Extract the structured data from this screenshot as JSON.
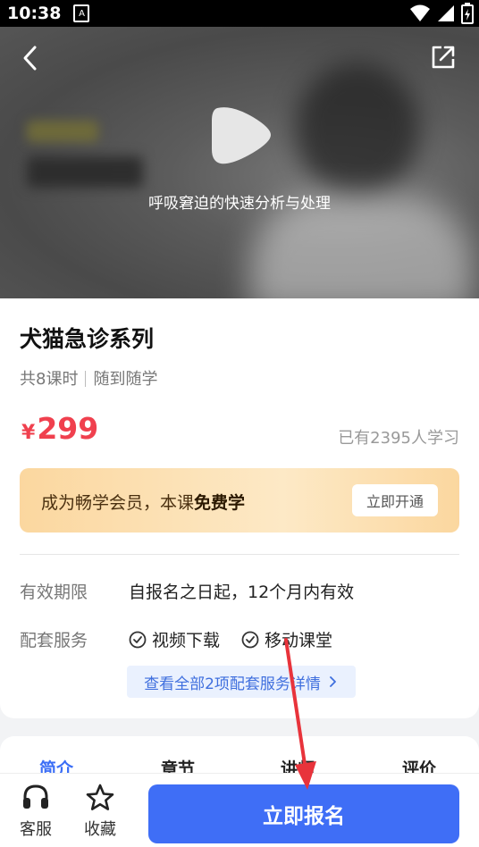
{
  "status_bar": {
    "time": "10:38",
    "a_icon": "A"
  },
  "video": {
    "title": "呼吸窘迫的快速分析与处理"
  },
  "course": {
    "title": "犬猫急诊系列",
    "lessons": "共8课时",
    "mode": "随到随学",
    "currency": "¥",
    "price": "299",
    "learners": "已有2395人学习"
  },
  "vip": {
    "text_prefix": "成为畅学会员，本课",
    "text_bold": "免费学",
    "button": "立即开通"
  },
  "details": {
    "validity_label": "有效期限",
    "validity_value": "自报名之日起，12个月内有效",
    "services_label": "配套服务",
    "services": [
      "视频下载",
      "移动课堂"
    ],
    "services_link": "查看全部2项配套服务详情"
  },
  "tabs": [
    "简介",
    "章节",
    "讲师",
    "评价"
  ],
  "bottom_bar": {
    "service": "客服",
    "favorite": "收藏",
    "enroll": "立即报名"
  },
  "colors": {
    "accent": "#3f6ef6",
    "price": "#f0404e",
    "arrow": "#e8333b"
  }
}
